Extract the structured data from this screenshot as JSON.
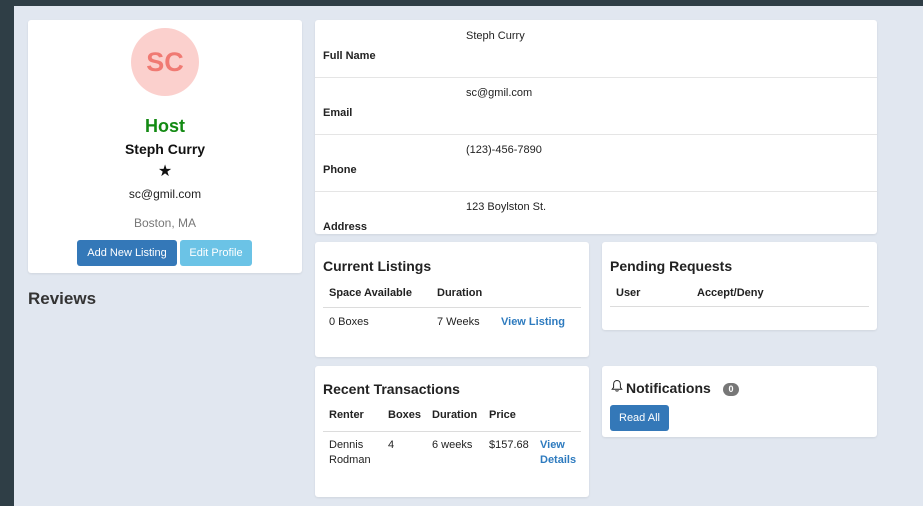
{
  "profile": {
    "initials": "SC",
    "role": "Host",
    "name": "Steph Curry",
    "rating_stars": "★",
    "email": "sc@gmil.com",
    "location": "Boston, MA",
    "add_listing_label": "Add New Listing",
    "edit_profile_label": "Edit Profile"
  },
  "reviews": {
    "title": "Reviews"
  },
  "info": {
    "rows": [
      {
        "label": "Full Name",
        "value": "Steph Curry"
      },
      {
        "label": "Email",
        "value": "sc@gmil.com"
      },
      {
        "label": "Phone",
        "value": "(123)-456-7890"
      },
      {
        "label": "Address",
        "value": "123 Boylston St."
      }
    ]
  },
  "listings": {
    "title": "Current Listings",
    "columns": [
      "Space Available",
      "Duration"
    ],
    "rows": [
      {
        "space": "0 Boxes",
        "duration": "7 Weeks",
        "action": "View Listing"
      }
    ]
  },
  "pending": {
    "title": "Pending Requests",
    "columns": [
      "User",
      "Accept/Deny"
    ]
  },
  "transactions": {
    "title": "Recent Transactions",
    "columns": [
      "Renter",
      "Boxes",
      "Duration",
      "Price"
    ],
    "rows": [
      {
        "renter_first": "Dennis",
        "renter_last": "Rodman",
        "boxes": "4",
        "duration": "6 weeks",
        "price": "$157.68",
        "action_1": "View",
        "action_2": "Details"
      }
    ]
  },
  "notifications": {
    "title": "Notifications",
    "count": "0",
    "read_all_label": "Read All"
  },
  "colors": {
    "accent": "#3478b8",
    "info_button": "#6bc3e6",
    "host_green": "#138a13",
    "avatar_bg": "#fbd0cd",
    "avatar_text": "#f07a73",
    "link": "#2e7bbf",
    "page_bg": "#e1e7f0",
    "frame": "#2f3e46"
  }
}
